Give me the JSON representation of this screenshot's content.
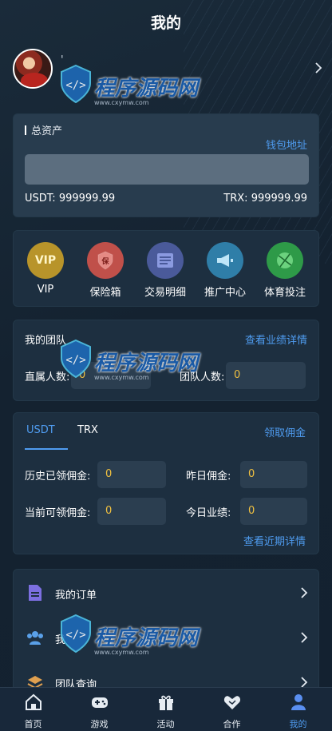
{
  "header": {
    "title": "我的"
  },
  "profile": {
    "username": "'"
  },
  "assets": {
    "label": "总资产",
    "wallet_link": "钱包地址",
    "usdt_label": "USDT:",
    "usdt_value": "999999.99",
    "trx_label": "TRX:",
    "trx_value": "999999.99"
  },
  "quick": [
    {
      "label": "VIP",
      "icon": "vip-icon",
      "color": "#b8942a"
    },
    {
      "label": "保险箱",
      "icon": "safe-icon",
      "color": "#c0504a"
    },
    {
      "label": "交易明细",
      "icon": "transaction-icon",
      "color": "#4a5a9a"
    },
    {
      "label": "推广中心",
      "icon": "megaphone-icon",
      "color": "#2f7ea8"
    },
    {
      "label": "体育投注",
      "icon": "sports-ball-icon",
      "color": "#2e9a48"
    }
  ],
  "team": {
    "title": "我的团队",
    "detail_link": "查看业绩详情",
    "direct_label": "直属人数:",
    "direct_value": "0",
    "team_label": "团队人数:",
    "team_value": "0"
  },
  "commission": {
    "tabs": [
      "USDT",
      "TRX"
    ],
    "active_tab": "USDT",
    "claim_link": "领取佣金",
    "history_label": "历史已领佣金:",
    "history_value": "0",
    "yesterday_label": "昨日佣金:",
    "yesterday_value": "0",
    "current_label": "当前可领佣金:",
    "current_value": "0",
    "today_label": "今日业绩:",
    "today_value": "0",
    "recent_link": "查看近期详情"
  },
  "menu": [
    {
      "label": "我的订单",
      "icon": "document-icon"
    },
    {
      "label": "我",
      "icon": "users-icon"
    },
    {
      "label": "团队查询",
      "icon": "team-search-icon"
    }
  ],
  "nav": [
    {
      "label": "首页",
      "icon": "home-icon"
    },
    {
      "label": "游戏",
      "icon": "gamepad-icon"
    },
    {
      "label": "活动",
      "icon": "gift-icon"
    },
    {
      "label": "合作",
      "icon": "handshake-icon"
    },
    {
      "label": "我的",
      "icon": "user-icon",
      "active": true
    }
  ],
  "watermark": {
    "text": "程序源码网",
    "sub": "www.cxymw.com"
  },
  "colors": {
    "accent": "#4f9cf0",
    "value": "#f0c040",
    "background": "#142230"
  }
}
